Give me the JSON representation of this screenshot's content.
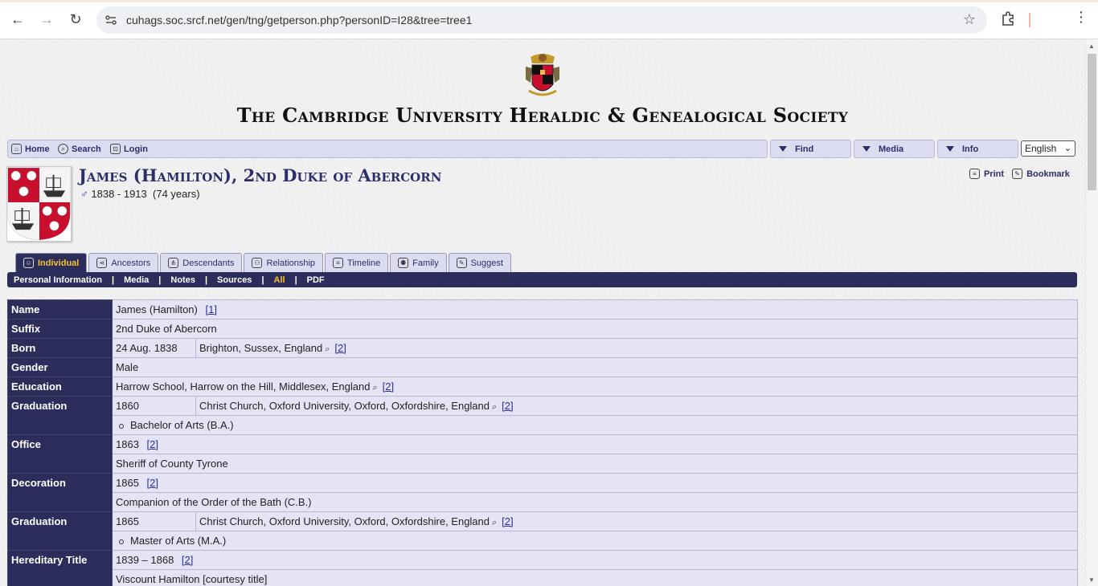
{
  "browser": {
    "url": "cuhags.soc.srcf.net/gen/tng/getperson.php?personID=I28&tree=tree1"
  },
  "site": {
    "title": "The Cambridge University Heraldic & Genealogical Society"
  },
  "topmenu": {
    "home": "Home",
    "search": "Search",
    "login": "Login",
    "find": "Find",
    "media": "Media",
    "info": "Info",
    "language": "English"
  },
  "person": {
    "name": "James (Hamilton), 2nd Duke of Abercorn",
    "sex_symbol": "♂",
    "dates": "1838 - 1913",
    "age": "(74 years)"
  },
  "actions": {
    "print": "Print",
    "bookmark": "Bookmark"
  },
  "tabs": [
    "Individual",
    "Ancestors",
    "Descendants",
    "Relationship",
    "Timeline",
    "Family",
    "Suggest"
  ],
  "subnav": [
    "Personal Information",
    "Media",
    "Notes",
    "Sources",
    "All",
    "PDF"
  ],
  "facts": {
    "name": {
      "label": "Name",
      "value": "James (Hamilton)",
      "cite": "[1]"
    },
    "suffix": {
      "label": "Suffix",
      "value": "2nd Duke of Abercorn"
    },
    "born": {
      "label": "Born",
      "date": "24 Aug. 1838",
      "place": "Brighton, Sussex, England",
      "cite": "[2]"
    },
    "gender": {
      "label": "Gender",
      "value": "Male"
    },
    "education": {
      "label": "Education",
      "value": "Harrow School, Harrow on the Hill, Middlesex, England",
      "cite": "[2]"
    },
    "graduation1": {
      "label": "Graduation",
      "date": "1860",
      "place": "Christ Church, Oxford University, Oxford, Oxfordshire, England",
      "cite": "[2]",
      "note": "Bachelor of Arts (B.A.)"
    },
    "office": {
      "label": "Office",
      "date": "1863",
      "cite": "[2]",
      "note": "Sheriff of County Tyrone"
    },
    "decoration": {
      "label": "Decoration",
      "date": "1865",
      "cite": "[2]",
      "note": "Companion of the Order of the Bath (C.B.)"
    },
    "graduation2": {
      "label": "Graduation",
      "date": "1865",
      "place": "Christ Church, Oxford University, Oxford, Oxfordshire, England",
      "cite": "[2]",
      "note": "Master of Arts (M.A.)"
    },
    "hereditary": {
      "label": "Hereditary Title",
      "date": "1839 – 1868",
      "cite": "[2]",
      "note": "Viscount Hamilton [courtesy title]"
    }
  }
}
